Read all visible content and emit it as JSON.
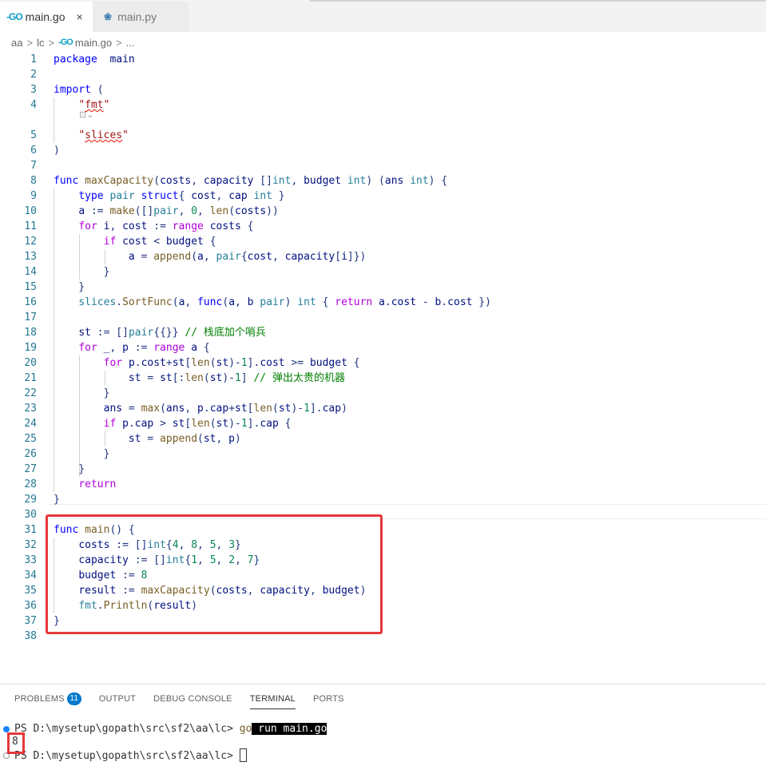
{
  "tabs": [
    {
      "icon": "go-file-icon",
      "glyph": "-GO",
      "label": "main.go",
      "close": "×"
    },
    {
      "icon": "python-file-icon",
      "glyph": "❀",
      "label": "main.py"
    }
  ],
  "breadcrumb": {
    "parts": [
      "aa",
      "lc",
      "main.go",
      "..."
    ],
    "sep": ">"
  },
  "editor": {
    "line_numbers": [
      "1",
      "2",
      "3",
      "4",
      "5",
      "6",
      "7",
      "8",
      "9",
      "10",
      "11",
      "12",
      "13",
      "14",
      "15",
      "16",
      "17",
      "18",
      "19",
      "20",
      "21",
      "22",
      "23",
      "24",
      "25",
      "26",
      "27",
      "28",
      "29",
      "30",
      "31",
      "32",
      "33",
      "34",
      "35",
      "36",
      "37",
      "38"
    ],
    "codelens": "⊡⌄",
    "lines": [
      [
        [
          "kw",
          "package"
        ],
        [
          "",
          "  "
        ],
        [
          "id",
          "main"
        ]
      ],
      [],
      [
        [
          "kw",
          "import"
        ],
        [
          "",
          " ("
        ]
      ],
      [
        [
          "",
          "    "
        ],
        [
          "str",
          "\""
        ],
        [
          "str sq",
          "fmt"
        ],
        [
          "str",
          "\""
        ]
      ],
      [
        [
          "",
          "    "
        ],
        [
          "str",
          "\""
        ],
        [
          "str sq",
          "slices"
        ],
        [
          "str",
          "\""
        ]
      ],
      [
        [
          "",
          ")"
        ]
      ],
      [],
      [
        [
          "kw",
          "func"
        ],
        [
          "",
          " "
        ],
        [
          "fn",
          "maxCapacity"
        ],
        [
          "",
          "("
        ],
        [
          "id",
          "costs"
        ],
        [
          "",
          ", "
        ],
        [
          "id",
          "capacity"
        ],
        [
          "",
          " []"
        ],
        [
          "ty",
          "int"
        ],
        [
          "",
          ", "
        ],
        [
          "id",
          "budget"
        ],
        [
          "",
          " "
        ],
        [
          "ty",
          "int"
        ],
        [
          "",
          ") ("
        ],
        [
          "id",
          "ans"
        ],
        [
          "",
          " "
        ],
        [
          "ty",
          "int"
        ],
        [
          "",
          ") {"
        ]
      ],
      [
        [
          "",
          "    "
        ],
        [
          "kw",
          "type"
        ],
        [
          "",
          " "
        ],
        [
          "ty",
          "pair"
        ],
        [
          "",
          " "
        ],
        [
          "kw",
          "struct"
        ],
        [
          "",
          "{ "
        ],
        [
          "id",
          "cost"
        ],
        [
          "",
          ", "
        ],
        [
          "id",
          "cap"
        ],
        [
          "",
          " "
        ],
        [
          "ty",
          "int"
        ],
        [
          "",
          " }"
        ]
      ],
      [
        [
          "",
          "    "
        ],
        [
          "id",
          "a"
        ],
        [
          "",
          " := "
        ],
        [
          "fn",
          "make"
        ],
        [
          "",
          "([]"
        ],
        [
          "ty",
          "pair"
        ],
        [
          "",
          ", "
        ],
        [
          "num",
          "0"
        ],
        [
          "",
          ", "
        ],
        [
          "fn",
          "len"
        ],
        [
          "",
          "("
        ],
        [
          "id",
          "costs"
        ],
        [
          "",
          "))"
        ]
      ],
      [
        [
          "",
          "    "
        ],
        [
          "ctl",
          "for"
        ],
        [
          "",
          " "
        ],
        [
          "id",
          "i"
        ],
        [
          "",
          ", "
        ],
        [
          "id",
          "cost"
        ],
        [
          "",
          " := "
        ],
        [
          "ctl",
          "range"
        ],
        [
          "",
          " "
        ],
        [
          "id",
          "costs"
        ],
        [
          "",
          " {"
        ]
      ],
      [
        [
          "",
          "        "
        ],
        [
          "ctl",
          "if"
        ],
        [
          "",
          " "
        ],
        [
          "id",
          "cost"
        ],
        [
          "",
          " < "
        ],
        [
          "id",
          "budget"
        ],
        [
          "",
          " {"
        ]
      ],
      [
        [
          "",
          "            "
        ],
        [
          "id",
          "a"
        ],
        [
          "",
          " = "
        ],
        [
          "fn",
          "append"
        ],
        [
          "",
          "("
        ],
        [
          "id",
          "a"
        ],
        [
          "",
          ", "
        ],
        [
          "ty",
          "pair"
        ],
        [
          "",
          "{"
        ],
        [
          "id",
          "cost"
        ],
        [
          "",
          ", "
        ],
        [
          "id",
          "capacity"
        ],
        [
          "",
          "["
        ],
        [
          "id",
          "i"
        ],
        [
          "",
          "]})"
        ]
      ],
      [
        [
          "",
          "        }"
        ]
      ],
      [
        [
          "",
          "    }"
        ]
      ],
      [
        [
          "",
          "    "
        ],
        [
          "ty",
          "slices"
        ],
        [
          "",
          "."
        ],
        [
          "fn",
          "SortFunc"
        ],
        [
          "",
          "("
        ],
        [
          "id",
          "a"
        ],
        [
          "",
          ", "
        ],
        [
          "kw",
          "func"
        ],
        [
          "",
          "("
        ],
        [
          "id",
          "a"
        ],
        [
          "",
          ", "
        ],
        [
          "id",
          "b"
        ],
        [
          "",
          " "
        ],
        [
          "ty",
          "pair"
        ],
        [
          "",
          ") "
        ],
        [
          "ty",
          "int"
        ],
        [
          "",
          " { "
        ],
        [
          "ctl",
          "return"
        ],
        [
          "",
          " "
        ],
        [
          "id",
          "a"
        ],
        [
          "",
          "."
        ],
        [
          "id",
          "cost"
        ],
        [
          "",
          " - "
        ],
        [
          "id",
          "b"
        ],
        [
          "",
          "."
        ],
        [
          "id",
          "cost"
        ],
        [
          "",
          " })"
        ]
      ],
      [],
      [
        [
          "",
          "    "
        ],
        [
          "id",
          "st"
        ],
        [
          "",
          " := []"
        ],
        [
          "ty",
          "pair"
        ],
        [
          "",
          "{{}} "
        ],
        [
          "cm",
          "// 栈底加个哨兵"
        ]
      ],
      [
        [
          "",
          "    "
        ],
        [
          "ctl",
          "for"
        ],
        [
          "",
          " "
        ],
        [
          "id",
          "_"
        ],
        [
          "",
          ", "
        ],
        [
          "id",
          "p"
        ],
        [
          "",
          " := "
        ],
        [
          "ctl",
          "range"
        ],
        [
          "",
          " "
        ],
        [
          "id",
          "a"
        ],
        [
          "",
          " {"
        ]
      ],
      [
        [
          "",
          "        "
        ],
        [
          "ctl",
          "for"
        ],
        [
          "",
          " "
        ],
        [
          "id",
          "p"
        ],
        [
          "",
          "."
        ],
        [
          "id",
          "cost"
        ],
        [
          "",
          "+"
        ],
        [
          "id",
          "st"
        ],
        [
          "",
          "["
        ],
        [
          "fn",
          "len"
        ],
        [
          "",
          "("
        ],
        [
          "id",
          "st"
        ],
        [
          "",
          ")-"
        ],
        [
          "num",
          "1"
        ],
        [
          "",
          "]."
        ],
        [
          "id",
          "cost"
        ],
        [
          "",
          " >= "
        ],
        [
          "id",
          "budget"
        ],
        [
          "",
          " {"
        ]
      ],
      [
        [
          "",
          "            "
        ],
        [
          "id",
          "st"
        ],
        [
          "",
          " = "
        ],
        [
          "id",
          "st"
        ],
        [
          "",
          "[:"
        ],
        [
          "fn",
          "len"
        ],
        [
          "",
          "("
        ],
        [
          "id",
          "st"
        ],
        [
          "",
          ")-"
        ],
        [
          "num",
          "1"
        ],
        [
          "",
          "] "
        ],
        [
          "cm",
          "// 弹出太贵的机器"
        ]
      ],
      [
        [
          "",
          "        }"
        ]
      ],
      [
        [
          "",
          "        "
        ],
        [
          "id",
          "ans"
        ],
        [
          "",
          " = "
        ],
        [
          "fn",
          "max"
        ],
        [
          "",
          "("
        ],
        [
          "id",
          "ans"
        ],
        [
          "",
          ", "
        ],
        [
          "id",
          "p"
        ],
        [
          "",
          "."
        ],
        [
          "id",
          "cap"
        ],
        [
          "",
          "+"
        ],
        [
          "id",
          "st"
        ],
        [
          "",
          "["
        ],
        [
          "fn",
          "len"
        ],
        [
          "",
          "("
        ],
        [
          "id",
          "st"
        ],
        [
          "",
          ")-"
        ],
        [
          "num",
          "1"
        ],
        [
          "",
          "]."
        ],
        [
          "id",
          "cap"
        ],
        [
          "",
          ")"
        ]
      ],
      [
        [
          "",
          "        "
        ],
        [
          "ctl",
          "if"
        ],
        [
          "",
          " "
        ],
        [
          "id",
          "p"
        ],
        [
          "",
          "."
        ],
        [
          "id",
          "cap"
        ],
        [
          "",
          " > "
        ],
        [
          "id",
          "st"
        ],
        [
          "",
          "["
        ],
        [
          "fn",
          "len"
        ],
        [
          "",
          "("
        ],
        [
          "id",
          "st"
        ],
        [
          "",
          ")-"
        ],
        [
          "num",
          "1"
        ],
        [
          "",
          "]."
        ],
        [
          "id",
          "cap"
        ],
        [
          "",
          " {"
        ]
      ],
      [
        [
          "",
          "            "
        ],
        [
          "id",
          "st"
        ],
        [
          "",
          " = "
        ],
        [
          "fn",
          "append"
        ],
        [
          "",
          "("
        ],
        [
          "id",
          "st"
        ],
        [
          "",
          ", "
        ],
        [
          "id",
          "p"
        ],
        [
          "",
          ")"
        ]
      ],
      [
        [
          "",
          "        }"
        ]
      ],
      [
        [
          "",
          "    }"
        ]
      ],
      [
        [
          "",
          "    "
        ],
        [
          "ctl",
          "return"
        ]
      ],
      [
        [
          "",
          "}"
        ]
      ],
      [],
      [
        [
          "kw",
          "func"
        ],
        [
          "",
          " "
        ],
        [
          "fn",
          "main"
        ],
        [
          "",
          "() {"
        ]
      ],
      [
        [
          "",
          "    "
        ],
        [
          "id",
          "costs"
        ],
        [
          "",
          " := []"
        ],
        [
          "ty",
          "int"
        ],
        [
          "",
          "{"
        ],
        [
          "num",
          "4"
        ],
        [
          "",
          ", "
        ],
        [
          "num",
          "8"
        ],
        [
          "",
          ", "
        ],
        [
          "num",
          "5"
        ],
        [
          "",
          ", "
        ],
        [
          "num",
          "3"
        ],
        [
          "",
          "}"
        ]
      ],
      [
        [
          "",
          "    "
        ],
        [
          "id",
          "capacity"
        ],
        [
          "",
          " := []"
        ],
        [
          "ty",
          "int"
        ],
        [
          "",
          "{"
        ],
        [
          "num",
          "1"
        ],
        [
          "",
          ", "
        ],
        [
          "num",
          "5"
        ],
        [
          "",
          ", "
        ],
        [
          "num",
          "2"
        ],
        [
          "",
          ", "
        ],
        [
          "num",
          "7"
        ],
        [
          "",
          "}"
        ]
      ],
      [
        [
          "",
          "    "
        ],
        [
          "id",
          "budget"
        ],
        [
          "",
          " := "
        ],
        [
          "num",
          "8"
        ]
      ],
      [
        [
          "",
          "    "
        ],
        [
          "id",
          "result"
        ],
        [
          "",
          " := "
        ],
        [
          "fn",
          "maxCapacity"
        ],
        [
          "",
          "("
        ],
        [
          "id",
          "costs"
        ],
        [
          "",
          ", "
        ],
        [
          "id",
          "capacity"
        ],
        [
          "",
          ", "
        ],
        [
          "id",
          "budget"
        ],
        [
          "",
          ")"
        ]
      ],
      [
        [
          "",
          "    "
        ],
        [
          "ty",
          "fmt"
        ],
        [
          "",
          "."
        ],
        [
          "fn",
          "Println"
        ],
        [
          "",
          "("
        ],
        [
          "id",
          "result"
        ],
        [
          "",
          ")"
        ]
      ],
      [
        [
          "",
          "}"
        ]
      ],
      []
    ]
  },
  "panel": {
    "tabs": [
      {
        "label": "PROBLEMS",
        "badge": "11"
      },
      {
        "label": "OUTPUT"
      },
      {
        "label": "DEBUG CONSOLE"
      },
      {
        "label": "TERMINAL",
        "active": true
      },
      {
        "label": "PORTS"
      }
    ]
  },
  "terminal": {
    "prompt1": "PS D:\\mysetup\\gopath\\src\\sf2\\aa\\lc> ",
    "cmd_go": "go",
    "cmd_rest": " run main.go",
    "output": "8",
    "prompt2": "PS D:\\mysetup\\gopath\\src\\sf2\\aa\\lc> "
  }
}
